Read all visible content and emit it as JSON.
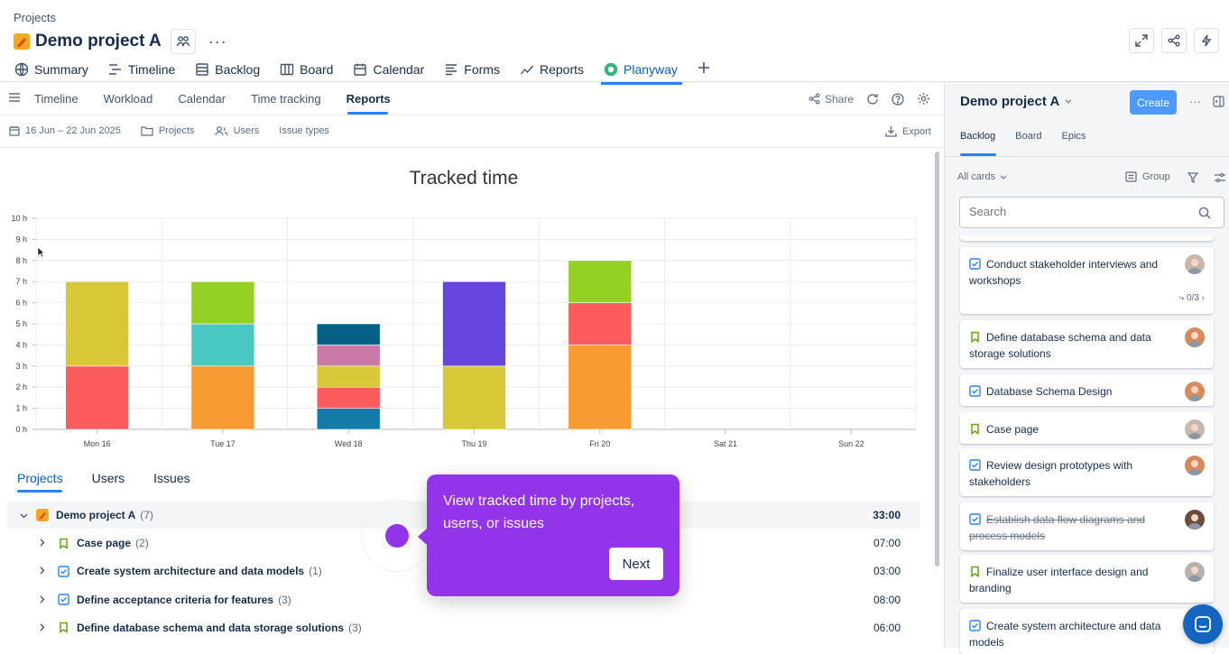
{
  "breadcrumb": "Projects",
  "project": {
    "title": "Demo project A"
  },
  "tabs": [
    {
      "label": "Summary",
      "icon": "globe-icon"
    },
    {
      "label": "Timeline",
      "icon": "timeline-icon"
    },
    {
      "label": "Backlog",
      "icon": "backlog-icon"
    },
    {
      "label": "Board",
      "icon": "board-icon"
    },
    {
      "label": "Calendar",
      "icon": "calendar-icon"
    },
    {
      "label": "Forms",
      "icon": "forms-icon"
    },
    {
      "label": "Reports",
      "icon": "reports-icon"
    },
    {
      "label": "Planyway",
      "icon": "planyway-icon"
    }
  ],
  "subtabs": [
    "Timeline",
    "Workload",
    "Calendar",
    "Time tracking",
    "Reports"
  ],
  "toolbar": {
    "share": "Share",
    "export": "Export"
  },
  "filters": {
    "date": "16 Jun – 22 Jun 2025",
    "projects": "Projects",
    "users": "Users",
    "issue_types": "Issue types"
  },
  "chart_data": {
    "type": "bar",
    "title": "Tracked time",
    "categories": [
      "Mon 16",
      "Tue 17",
      "Wed 18",
      "Thu 19",
      "Fri 20",
      "Sat 21",
      "Sun 22"
    ],
    "yticks": [
      "0 h",
      "1 h",
      "2 h",
      "3 h",
      "4 h",
      "5 h",
      "6 h",
      "7 h",
      "8 h",
      "9 h",
      "10 h"
    ],
    "ylim": [
      0,
      10
    ],
    "stacks": [
      [
        {
          "v": 3,
          "c": "#fc5c5c"
        },
        {
          "v": 4,
          "c": "#d8c838"
        }
      ],
      [
        {
          "v": 3,
          "c": "#f99b33"
        },
        {
          "v": 2,
          "c": "#4ac8c2"
        },
        {
          "v": 2,
          "c": "#94d124"
        }
      ],
      [
        {
          "v": 1,
          "c": "#147aa8"
        },
        {
          "v": 1,
          "c": "#fc5c5c"
        },
        {
          "v": 1,
          "c": "#d8c838"
        },
        {
          "v": 1,
          "c": "#c978a8"
        },
        {
          "v": 1,
          "c": "#055f87"
        }
      ],
      [
        {
          "v": 3,
          "c": "#d8c838"
        },
        {
          "v": 4,
          "c": "#6544e0"
        }
      ],
      [
        {
          "v": 4,
          "c": "#f99b33"
        },
        {
          "v": 2,
          "c": "#fc5c5c"
        },
        {
          "v": 2,
          "c": "#94d124"
        }
      ],
      [],
      []
    ]
  },
  "bottom_tabs": [
    "Projects",
    "Users",
    "Issues"
  ],
  "tree": {
    "root": {
      "label": "Demo project A",
      "count": "(7)",
      "value": "33:00"
    },
    "rows": [
      {
        "label": "Case page",
        "count": "(2)",
        "value": "07:00",
        "type": "story"
      },
      {
        "label": "Create system architecture and data models",
        "count": "(1)",
        "value": "03:00",
        "type": "task"
      },
      {
        "label": "Define acceptance criteria for features",
        "count": "(3)",
        "value": "08:00",
        "type": "task"
      },
      {
        "label": "Define database schema and data storage solutions",
        "count": "(3)",
        "value": "06:00",
        "type": "story"
      }
    ]
  },
  "tooltip": {
    "text": "View tracked time by projects, users, or issues",
    "next": "Next"
  },
  "sidebar": {
    "title": "Demo project A",
    "create": "Create",
    "tabs": [
      "Backlog",
      "Board",
      "Epics"
    ],
    "all_cards": "All cards",
    "group": "Group",
    "search_placeholder": "Search",
    "cards": [
      {
        "text": "Conduct stakeholder interviews and workshops",
        "type": "task",
        "meta": "0/3"
      },
      {
        "text": "Define database schema and data storage solutions",
        "type": "story"
      },
      {
        "text": "Database Schema Design",
        "type": "task"
      },
      {
        "text": "Case page",
        "type": "story"
      },
      {
        "text": "Review design prototypes with stakeholders",
        "type": "task"
      },
      {
        "text": "Establish data flow diagrams and process models",
        "type": "task",
        "done": true
      },
      {
        "text": "Finalize user interface design and branding",
        "type": "story"
      },
      {
        "text": "Create system architecture and data models",
        "type": "task"
      }
    ]
  }
}
